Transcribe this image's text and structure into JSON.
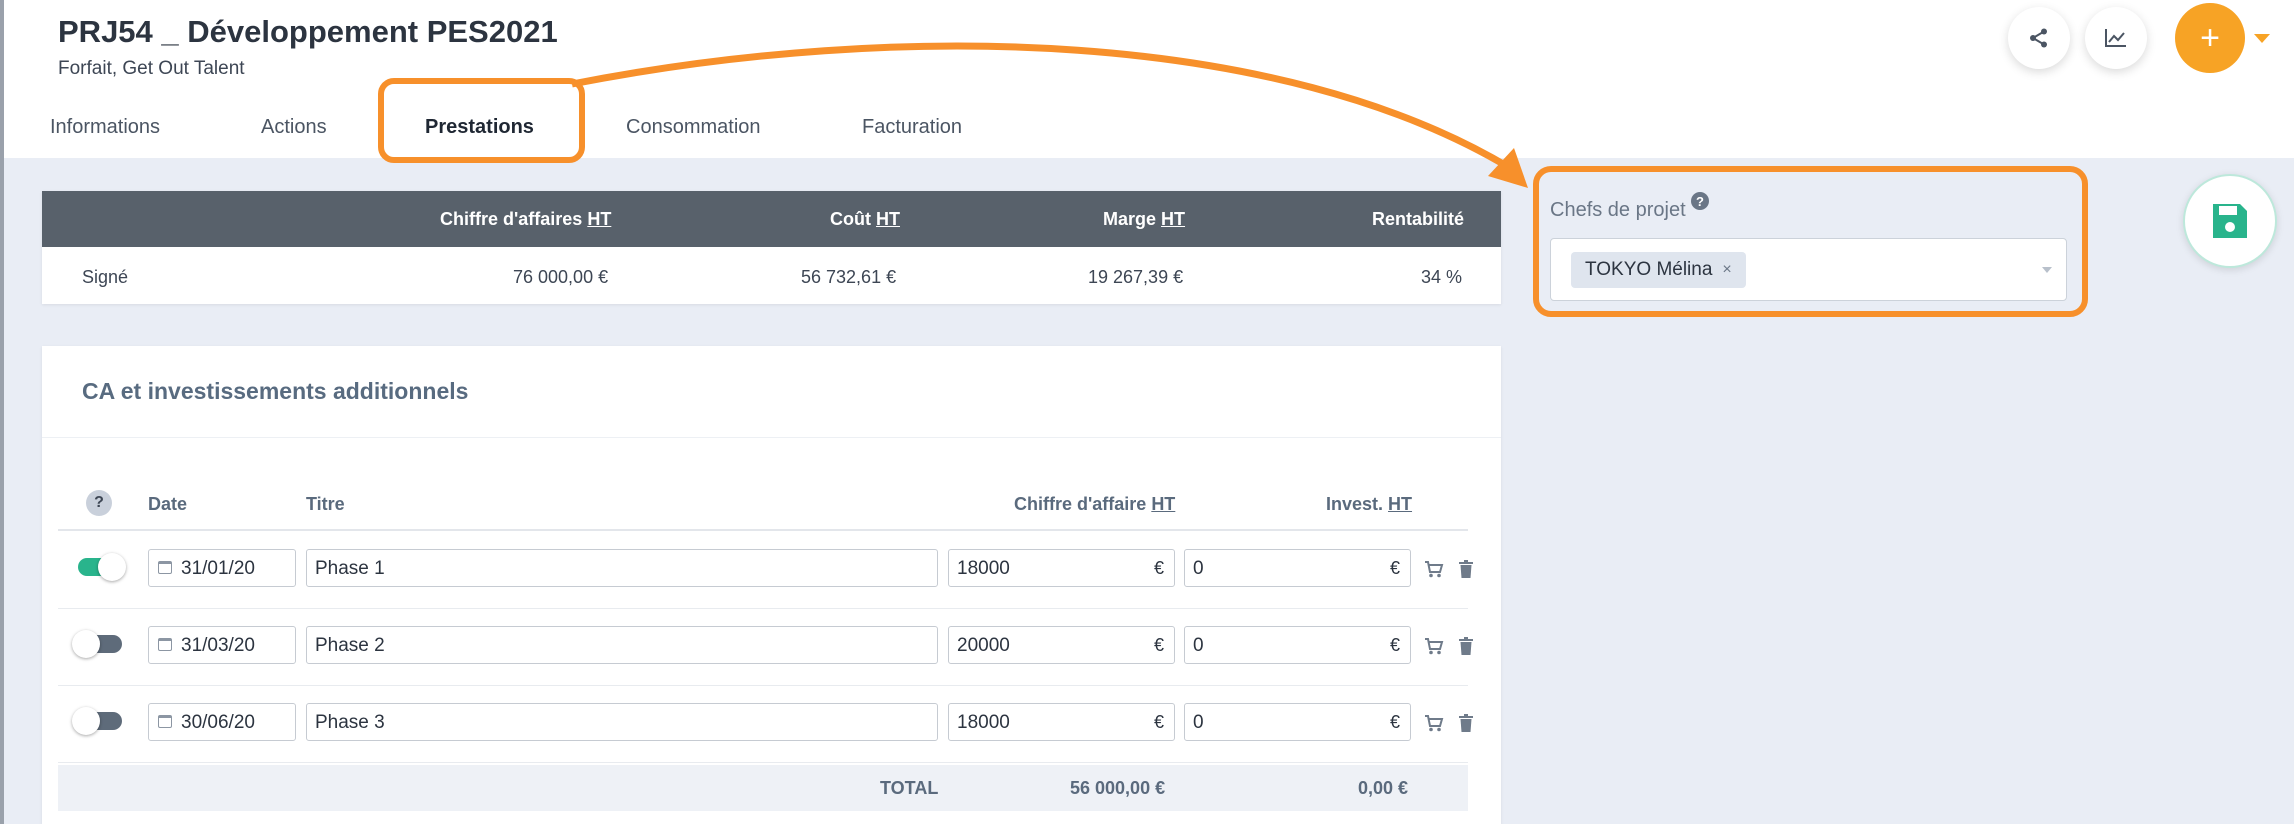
{
  "header": {
    "title": "PRJ54 _ Développement PES2021",
    "subtitle": "Forfait, Get Out Talent"
  },
  "tabs": [
    {
      "label": "Informations"
    },
    {
      "label": "Actions"
    },
    {
      "label": "Prestations"
    },
    {
      "label": "Consommation"
    },
    {
      "label": "Facturation"
    }
  ],
  "actions": {
    "share_icon": "share-icon",
    "chart_icon": "chart-icon",
    "add_label": "+"
  },
  "summary": {
    "headers": {
      "ca": "Chiffre d'affaires ",
      "cout": "Coût ",
      "marge": "Marge ",
      "rentabilite": "Rentabilité",
      "ht": "HT"
    },
    "row": {
      "label": "Signé",
      "ca": "76 000,00 €",
      "cout": "56 732,61 €",
      "marge": "19 267,39 €",
      "rentabilite": "34 %"
    }
  },
  "ca_section": {
    "title": "CA et investissements additionnels",
    "help": "?",
    "columns": {
      "date": "Date",
      "titre": "Titre",
      "ca": "Chiffre d'affaire ",
      "invest": "Invest. ",
      "ht": "HT"
    },
    "rows": [
      {
        "enabled": true,
        "date": "31/01/20",
        "titre": "Phase 1",
        "ca": "18000",
        "invest": "0"
      },
      {
        "enabled": false,
        "date": "31/03/20",
        "titre": "Phase 2",
        "ca": "20000",
        "invest": "0"
      },
      {
        "enabled": false,
        "date": "30/06/20",
        "titre": "Phase 3",
        "ca": "18000",
        "invest": "0"
      }
    ],
    "currency": "€",
    "total": {
      "label": "TOTAL",
      "ca": "56 000,00 €",
      "invest": "0,00 €"
    }
  },
  "chefs": {
    "label": "Chefs de projet",
    "help": "?",
    "tag": "TOKYO Mélina",
    "tag_remove": "×"
  },
  "colors": {
    "accent": "#f7a325",
    "annotation": "#f7902b",
    "toggle_on": "#29b48c",
    "table_header": "#58616b"
  }
}
